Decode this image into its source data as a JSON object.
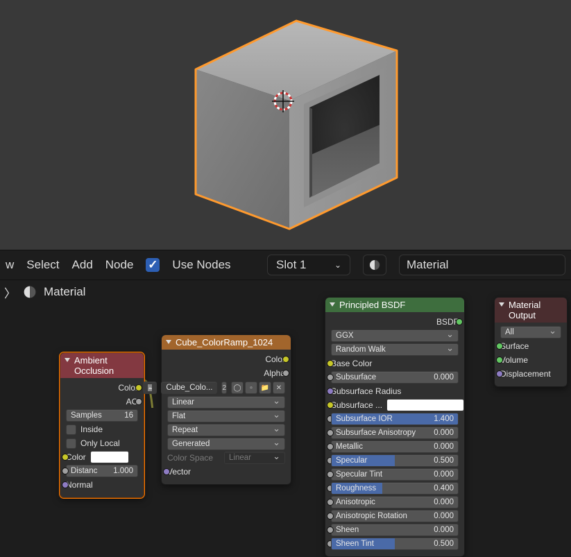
{
  "menubar": {
    "view_partial": "w",
    "select": "Select",
    "add": "Add",
    "node": "Node",
    "use_nodes": "Use Nodes",
    "slot": "Slot 1",
    "material": "Material"
  },
  "breadcrumb": {
    "label": "Material"
  },
  "nodes": {
    "ao": {
      "title": "Ambient Occlusion",
      "out_color": "Color",
      "out_ao": "AO",
      "samples_label": "Samples",
      "samples_value": "16",
      "inside": "Inside",
      "only_local": "Only Local",
      "in_color": "Color",
      "distance_label": "Distanc",
      "distance_value": "1.000",
      "in_normal": "Normal"
    },
    "img": {
      "title": "Cube_ColorRamp_1024",
      "out_color": "Color",
      "out_alpha": "Alpha",
      "tex_name": "Cube_Colo...",
      "tex_users": "2",
      "interp": "Linear",
      "proj": "Flat",
      "ext": "Repeat",
      "source": "Generated",
      "cs_label": "Color Space",
      "cs_value": "Linear",
      "in_vector": "Vector"
    },
    "bsdf": {
      "title": "Principled BSDF",
      "out_bsdf": "BSDF",
      "dist": "GGX",
      "sss_method": "Random Walk",
      "base_color": "Base Color",
      "subsurface_label": "Subsurface",
      "subsurface_value": "0.000",
      "subsurf_radius": "Subsurface Radius",
      "subsurf_color": "Subsurface ...",
      "ss_ior_label": "Subsurface IOR",
      "ss_ior_value": "1.400",
      "ss_aniso_label": "Subsurface Anisotropy",
      "ss_aniso_value": "0.000",
      "metallic_label": "Metallic",
      "metallic_value": "0.000",
      "specular_label": "Specular",
      "specular_value": "0.500",
      "spectint_label": "Specular Tint",
      "spectint_value": "0.000",
      "rough_label": "Roughness",
      "rough_value": "0.400",
      "aniso_label": "Anisotropic",
      "aniso_value": "0.000",
      "aniso_rot_label": "Anisotropic Rotation",
      "aniso_rot_value": "0.000",
      "sheen_label": "Sheen",
      "sheen_value": "0.000",
      "sheentint_label": "Sheen Tint",
      "sheentint_value": "0.500"
    },
    "out": {
      "title": "Material Output",
      "target": "All",
      "surface": "Surface",
      "volume": "Volume",
      "displacement": "Displacement"
    }
  }
}
